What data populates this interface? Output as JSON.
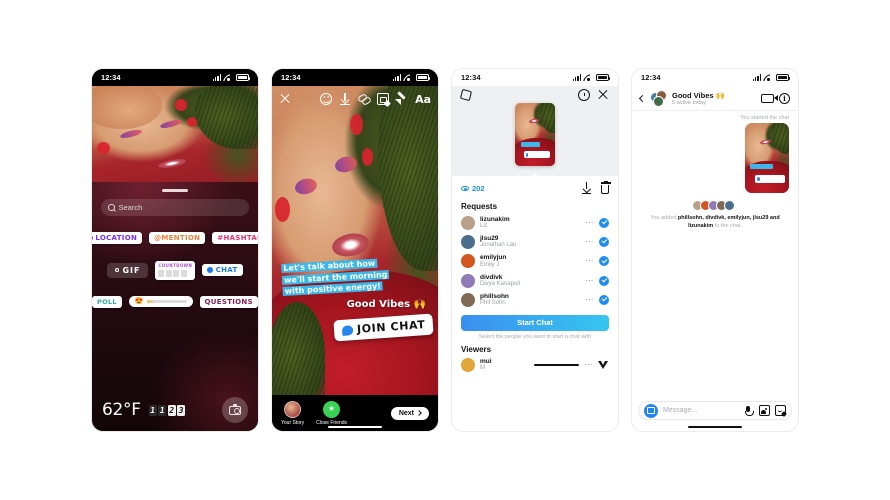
{
  "phones": [
    {
      "id": "sticker-tray",
      "status": {
        "time": "12:34"
      },
      "search": {
        "placeholder": "Search",
        "icon": "search-icon"
      },
      "stickers_row1": [
        {
          "label": "LOCATION",
          "style": "loc",
          "icon": "location-pin-icon"
        },
        {
          "label": "@MENTION",
          "style": "men"
        },
        {
          "label": "#HASHTAG",
          "style": "hash"
        }
      ],
      "stickers_row2": [
        {
          "label": "GIF",
          "style": "gif"
        },
        {
          "label": "COUNTDOWN",
          "style": "countdown"
        },
        {
          "label": "CHAT",
          "style": "chat",
          "icon": "chat-bubble-icon"
        }
      ],
      "stickers_row3": [
        {
          "label": "POLL",
          "style": "poll"
        },
        {
          "label": "",
          "style": "slider",
          "emoji": "😍"
        },
        {
          "label": "QUESTIONS",
          "style": "ques"
        }
      ],
      "bottom": {
        "temperature": "62°F",
        "clock_digits": [
          "1",
          "1",
          "2",
          "3"
        ],
        "camera_icon": "camera-icon"
      }
    },
    {
      "id": "story-editor",
      "status": {
        "time": "12:34"
      },
      "tools": [
        "close-icon",
        "emoji-icon",
        "download-icon",
        "link-icon",
        "sticker-icon",
        "pen-icon",
        "Aa"
      ],
      "text_overlay": [
        "Let's talk about how",
        "we'll start the morning",
        "with positive energy!"
      ],
      "good_vibes": "Good Vibes 🙌",
      "join_chat": "JOIN CHAT",
      "destinations": [
        {
          "label": "Your Story",
          "avatar": "story"
        },
        {
          "label": "Close Friends",
          "avatar": "cf"
        }
      ],
      "next_label": "Next"
    },
    {
      "id": "viewers-sheet",
      "status": {
        "time": "12:34"
      },
      "view_count": "202",
      "requests_header": "Requests",
      "requests": [
        {
          "username": "lizunakim",
          "name": "Liz",
          "selected": true,
          "color": "#b9a08a"
        },
        {
          "username": "jlsu29",
          "name": "Jonathan Lau",
          "selected": true,
          "color": "#4a6d8c"
        },
        {
          "username": "emilyjun",
          "name": "Emily J",
          "selected": true,
          "color": "#d2561f"
        },
        {
          "username": "divdivk",
          "name": "Divya Kanapuli",
          "selected": true,
          "color": "#8e7bb8"
        },
        {
          "username": "phillsohn",
          "name": "Phil Sohn",
          "selected": true,
          "color": "#7f6a55"
        }
      ],
      "start_chat": "Start Chat",
      "hint": "Select the people you want to start a chat with",
      "viewers_header": "Viewers",
      "viewers": [
        {
          "username": "mui",
          "name": "M",
          "color": "#e0a63a"
        }
      ]
    },
    {
      "id": "group-chat",
      "status": {
        "time": "12:34"
      },
      "title": "Good Vibes 🙌",
      "subtitle": "5 active today",
      "system_sent": "You started the chat",
      "system_note_prefix": "You added ",
      "system_note_names": "phillsohn, divdivk, emilyjun, jlsu29 and lizunakim",
      "system_note_suffix": " to the chat.",
      "composer_placeholder": "Message...",
      "composer_icons": [
        "camera-icon",
        "mic-icon",
        "gallery-icon",
        "sticker-icon"
      ],
      "header_icons": [
        "back-icon",
        "video-call-icon",
        "info-icon"
      ]
    }
  ],
  "colors": {
    "accent_blue": "#1d8ef0",
    "gradient_start": "#3a8ff0",
    "gradient_end": "#36c6f0",
    "story_red": "#a5151f",
    "highlight_cyan": "#3cb7e8"
  }
}
